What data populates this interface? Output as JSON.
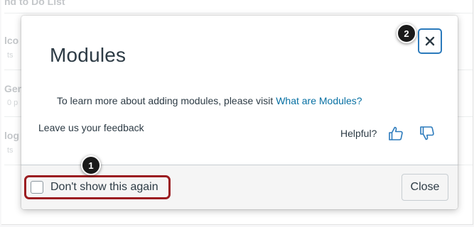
{
  "background": {
    "rows": [
      {
        "title": "nd to Do List",
        "sub": ""
      },
      {
        "title": "lco",
        "sub": "ts"
      },
      {
        "title": "Gen",
        "sub": "0 p"
      },
      {
        "title": "log",
        "sub": "ts"
      }
    ]
  },
  "modal": {
    "title": "Modules",
    "close_icon": "close-icon",
    "info_text": "To learn more about adding modules, please visit ",
    "info_link": "What are Modules?",
    "feedback_prompt": "Leave us your feedback",
    "helpful_label": "Helpful?",
    "thumbs_up_icon": "thumbs-up-icon",
    "thumbs_down_icon": "thumbs-down-icon",
    "footer": {
      "checkbox_label": "Don't show this again",
      "checkbox_checked": false,
      "close_button_label": "Close"
    }
  },
  "callouts": [
    "1",
    "2"
  ],
  "colors": {
    "link": "#0770a3",
    "focus_border": "#2b7abc",
    "callout_highlight": "#9b1d21",
    "callout_badge": "#1a1a1a",
    "text": "#2d3b45"
  }
}
